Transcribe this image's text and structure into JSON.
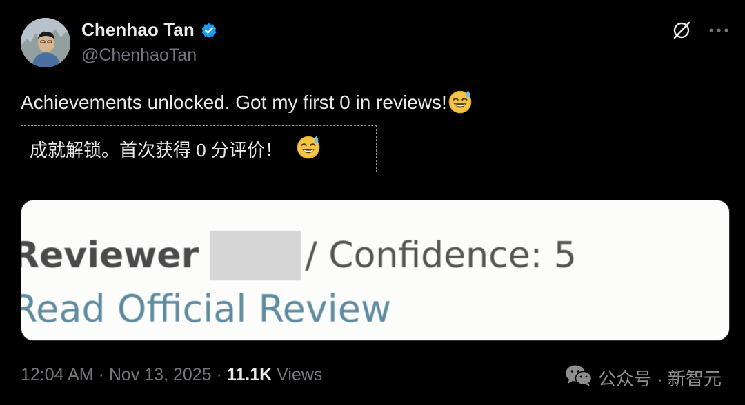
{
  "author": {
    "display_name": "Chenhao Tan",
    "handle": "@ChenhaoTan",
    "verified": true
  },
  "icons": {
    "verified": "verified-badge-icon",
    "grok": "grok-icon",
    "more": "more-icon",
    "emoji": "sweat-smile-emoji",
    "wechat": "wechat-icon"
  },
  "tweet": {
    "text": "Achievements unlocked. Got my first 0 in reviews!",
    "translation": "成就解锁。首次获得 0 分评价！"
  },
  "card": {
    "line1_prefix": "Reviewer",
    "line1_suffix": "/ Confidence: 5",
    "link_text": "Read Official Review"
  },
  "footer": {
    "time": "12:04 AM",
    "separator": "·",
    "date": "Nov 13, 2025",
    "views_count": "11.1K",
    "views_label": "Views"
  },
  "watermark": {
    "text": "公众号 · 新智元"
  },
  "colors": {
    "background": "#000000",
    "text_primary": "#e7e9ea",
    "text_secondary": "#71767b",
    "verified_blue": "#1d9bf0",
    "link_blue": "#5d8aa0"
  }
}
